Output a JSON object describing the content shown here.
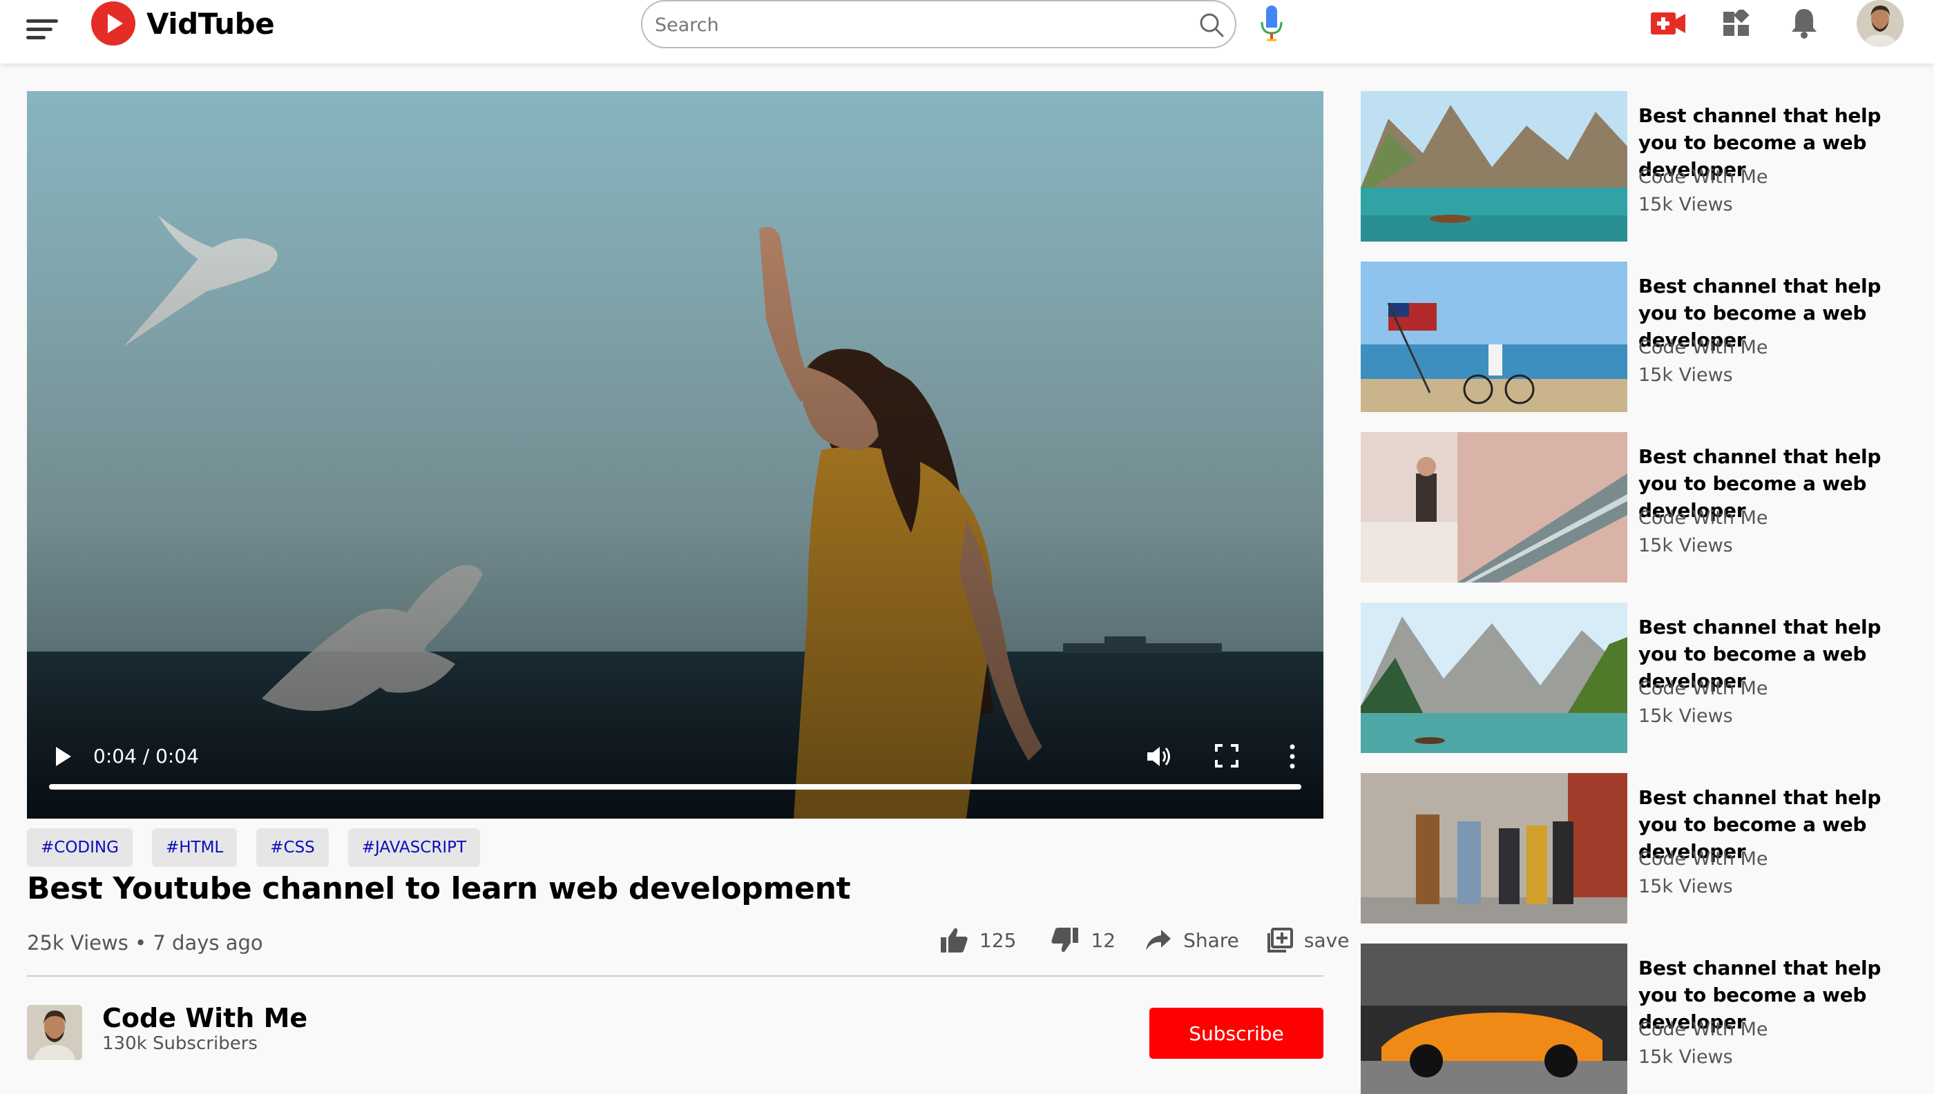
{
  "header": {
    "logo_text": "VidTube",
    "search_placeholder": "Search",
    "search_value": ""
  },
  "player": {
    "time_display": "0:04 / 0:04",
    "progress_fraction": 1.0
  },
  "video": {
    "tags": [
      "#CODING",
      "#HTML",
      "#CSS",
      "#JAVASCRIPT"
    ],
    "title": "Best Youtube channel to learn web development",
    "meta": "25k Views • 7 days ago",
    "likes": "125",
    "dislikes": "12",
    "share_label": "Share",
    "save_label": "save"
  },
  "channel": {
    "name": "Code With Me",
    "subscribers": "130k Subscribers",
    "subscribe_label": "Subscribe"
  },
  "sidebar": {
    "items": [
      {
        "title": "Best channel that help you to become a web developer",
        "channel": "Code With Me",
        "views": "15k Views",
        "thumb": "lake-mountains"
      },
      {
        "title": "Best channel that help you to become a web developer",
        "channel": "Code With Me",
        "views": "15k Views",
        "thumb": "beach-flag-bicycle"
      },
      {
        "title": "Best channel that help you to become a web developer",
        "channel": "Code With Me",
        "views": "15k Views",
        "thumb": "escalator-woman"
      },
      {
        "title": "Best channel that help you to become a web developer",
        "channel": "Code With Me",
        "views": "15k Views",
        "thumb": "alpine-lake-boat"
      },
      {
        "title": "Best channel that help you to become a web developer",
        "channel": "Code With Me",
        "views": "15k Views",
        "thumb": "friends-walking-street"
      },
      {
        "title": "Best channel that help you to become a web developer",
        "channel": "Code With Me",
        "views": "15k Views",
        "thumb": "orange-sports-car"
      }
    ]
  },
  "colors": {
    "brand_red": "#e52d27",
    "subscribe_red": "#ff0000",
    "tag_text": "#0b0bbe",
    "tag_bg": "#e6e6e6"
  }
}
